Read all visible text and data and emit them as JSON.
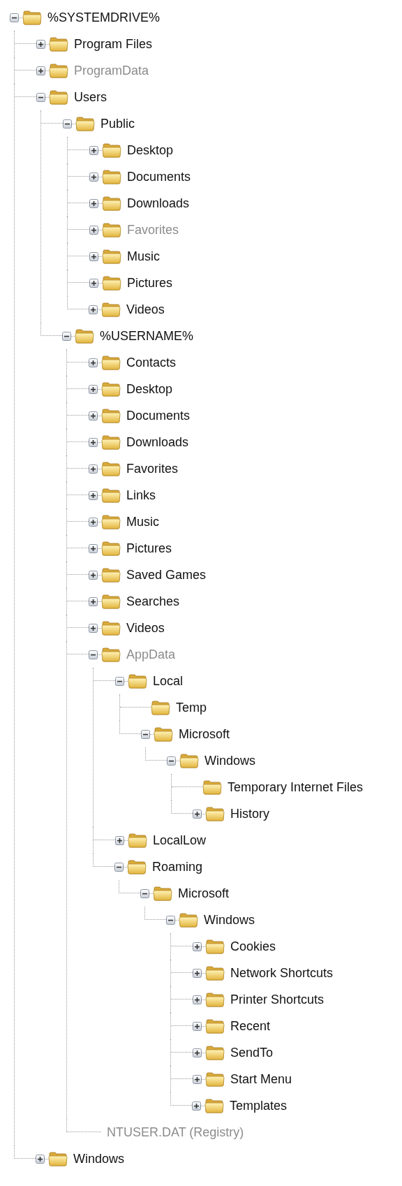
{
  "tree": [
    {
      "label": "%SYSTEMDRIVE%",
      "kind": "folder",
      "expanded": true,
      "hidden": false,
      "children": [
        {
          "label": "Program Files",
          "kind": "folder",
          "expanded": false,
          "hidden": false
        },
        {
          "label": "ProgramData",
          "kind": "folder",
          "expanded": false,
          "hidden": true
        },
        {
          "label": "Users",
          "kind": "folder",
          "expanded": true,
          "hidden": false,
          "children": [
            {
              "label": "Public",
              "kind": "folder",
              "expanded": true,
              "hidden": false,
              "children": [
                {
                  "label": "Desktop",
                  "kind": "folder",
                  "expanded": false,
                  "hidden": false
                },
                {
                  "label": "Documents",
                  "kind": "folder",
                  "expanded": false,
                  "hidden": false
                },
                {
                  "label": "Downloads",
                  "kind": "folder",
                  "expanded": false,
                  "hidden": false
                },
                {
                  "label": "Favorites",
                  "kind": "folder",
                  "expanded": false,
                  "hidden": true
                },
                {
                  "label": "Music",
                  "kind": "folder",
                  "expanded": false,
                  "hidden": false
                },
                {
                  "label": "Pictures",
                  "kind": "folder",
                  "expanded": false,
                  "hidden": false
                },
                {
                  "label": "Videos",
                  "kind": "folder",
                  "expanded": false,
                  "hidden": false
                }
              ]
            },
            {
              "label": "%USERNAME%",
              "kind": "folder",
              "expanded": true,
              "hidden": false,
              "children": [
                {
                  "label": "Contacts",
                  "kind": "folder",
                  "expanded": false,
                  "hidden": false
                },
                {
                  "label": "Desktop",
                  "kind": "folder",
                  "expanded": false,
                  "hidden": false
                },
                {
                  "label": "Documents",
                  "kind": "folder",
                  "expanded": false,
                  "hidden": false
                },
                {
                  "label": "Downloads",
                  "kind": "folder",
                  "expanded": false,
                  "hidden": false
                },
                {
                  "label": "Favorites",
                  "kind": "folder",
                  "expanded": false,
                  "hidden": false
                },
                {
                  "label": "Links",
                  "kind": "folder",
                  "expanded": false,
                  "hidden": false
                },
                {
                  "label": "Music",
                  "kind": "folder",
                  "expanded": false,
                  "hidden": false
                },
                {
                  "label": "Pictures",
                  "kind": "folder",
                  "expanded": false,
                  "hidden": false
                },
                {
                  "label": "Saved Games",
                  "kind": "folder",
                  "expanded": false,
                  "hidden": false
                },
                {
                  "label": "Searches",
                  "kind": "folder",
                  "expanded": false,
                  "hidden": false
                },
                {
                  "label": "Videos",
                  "kind": "folder",
                  "expanded": false,
                  "hidden": false
                },
                {
                  "label": "AppData",
                  "kind": "folder",
                  "expanded": true,
                  "hidden": true,
                  "children": [
                    {
                      "label": "Local",
                      "kind": "folder",
                      "expanded": true,
                      "hidden": false,
                      "children": [
                        {
                          "label": "Temp",
                          "kind": "leaf_folder",
                          "hidden": false
                        },
                        {
                          "label": "Microsoft",
                          "kind": "folder",
                          "expanded": true,
                          "hidden": false,
                          "children": [
                            {
                              "label": "Windows",
                              "kind": "folder",
                              "expanded": true,
                              "hidden": false,
                              "children": [
                                {
                                  "label": "Temporary Internet Files",
                                  "kind": "leaf_folder",
                                  "hidden": false
                                },
                                {
                                  "label": "History",
                                  "kind": "folder",
                                  "expanded": false,
                                  "hidden": false
                                }
                              ]
                            }
                          ]
                        }
                      ]
                    },
                    {
                      "label": "LocalLow",
                      "kind": "folder",
                      "expanded": false,
                      "hidden": false
                    },
                    {
                      "label": "Roaming",
                      "kind": "folder",
                      "expanded": true,
                      "hidden": false,
                      "children": [
                        {
                          "label": "Microsoft",
                          "kind": "folder",
                          "expanded": true,
                          "hidden": false,
                          "children": [
                            {
                              "label": "Windows",
                              "kind": "folder",
                              "expanded": true,
                              "hidden": false,
                              "children": [
                                {
                                  "label": "Cookies",
                                  "kind": "folder",
                                  "expanded": false,
                                  "hidden": false
                                },
                                {
                                  "label": "Network Shortcuts",
                                  "kind": "folder",
                                  "expanded": false,
                                  "hidden": false
                                },
                                {
                                  "label": "Printer Shortcuts",
                                  "kind": "folder",
                                  "expanded": false,
                                  "hidden": false
                                },
                                {
                                  "label": "Recent",
                                  "kind": "folder",
                                  "expanded": false,
                                  "hidden": false
                                },
                                {
                                  "label": "SendTo",
                                  "kind": "folder",
                                  "expanded": false,
                                  "hidden": false
                                },
                                {
                                  "label": "Start Menu",
                                  "kind": "folder",
                                  "expanded": false,
                                  "hidden": false
                                },
                                {
                                  "label": "Templates",
                                  "kind": "folder",
                                  "expanded": false,
                                  "hidden": false
                                }
                              ]
                            }
                          ]
                        }
                      ]
                    }
                  ]
                },
                {
                  "label": "NTUSER.DAT (Registry)",
                  "kind": "file",
                  "hidden": true
                }
              ]
            }
          ]
        },
        {
          "label": "Windows",
          "kind": "folder",
          "expanded": false,
          "hidden": false
        }
      ]
    }
  ]
}
